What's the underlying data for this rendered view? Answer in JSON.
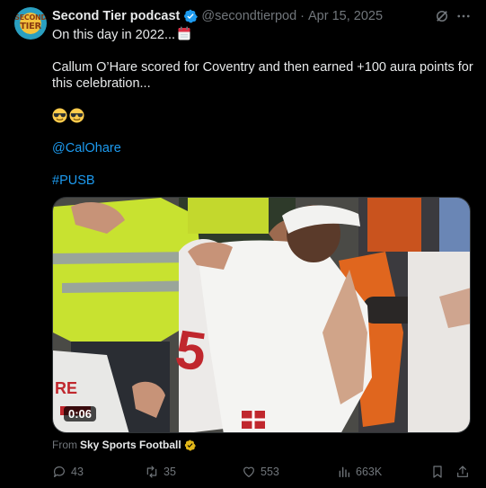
{
  "post": {
    "author_name": "Second Tier podcast",
    "handle": "@secondtierpod",
    "separator": "·",
    "date": "Apr 15, 2025",
    "avatar_text": [
      "SECOND",
      "TIER"
    ],
    "text_line_1": "On this day in 2022...",
    "text_line_2": "Callum O’Hare scored for Coventry and then earned +100 aura points for",
    "text_line_3": "this celebration...",
    "mention": "@CalOhare",
    "hashtag": "#PUSB",
    "emojis": [
      "sunglasses-emoji",
      "sunglasses-emoji"
    ],
    "calendar_icon": "calendar-icon"
  },
  "media": {
    "type": "video",
    "duration": "0:06"
  },
  "source": {
    "prefix": "From",
    "name": "Sky Sports Football"
  },
  "actions": {
    "replies": "43",
    "reposts": "35",
    "likes": "553",
    "views": "663K"
  },
  "colors": {
    "background": "#000000",
    "text": "#e7e9ea",
    "muted": "#71767b",
    "link": "#1d9bf0",
    "verified_blue": "#1d9bf0",
    "verified_gold": "#e2b719"
  }
}
